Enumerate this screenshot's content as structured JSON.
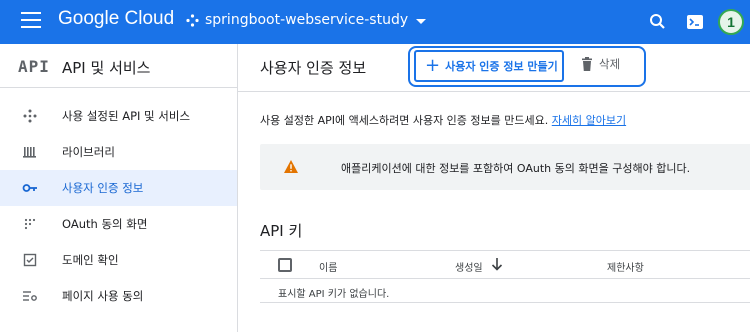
{
  "topbar": {
    "logo_text": "Google Cloud",
    "project_name": "springboot-webservice-study",
    "avatar_initial": "1",
    "brand_color": "#1a73e8"
  },
  "sidebar": {
    "logo_text": "API",
    "title": "API 및 서비스",
    "items": [
      {
        "label": "사용 설정된 API 및 서비스",
        "icon": "diamond-arrows-icon",
        "active": false
      },
      {
        "label": "라이브러리",
        "icon": "library-icon",
        "active": false
      },
      {
        "label": "사용자 인증 정보",
        "icon": "key-icon",
        "active": true
      },
      {
        "label": "OAuth 동의 화면",
        "icon": "oauth-dots-icon",
        "active": false
      },
      {
        "label": "도메인 확인",
        "icon": "checkbox-icon",
        "active": false
      },
      {
        "label": "페이지 사용 동의",
        "icon": "settings-list-icon",
        "active": false
      }
    ]
  },
  "main": {
    "title": "사용자 인증 정보",
    "create_button_label": "사용자 인증 정보 만들기",
    "delete_button_label": "삭제",
    "intro_text": "사용 설정한 API에 액세스하려면 사용자 인증 정보를 만드세요.",
    "intro_link": "자세히 알아보기",
    "banner_text": "애플리케이션에 대한 정보를 포함하여 OAuth 동의 화면을 구성해야 합니다.",
    "api_keys": {
      "title": "API 키",
      "columns": [
        "이름",
        "생성일",
        "제한사항"
      ],
      "empty_text": "표시할 API 키가 없습니다."
    }
  }
}
